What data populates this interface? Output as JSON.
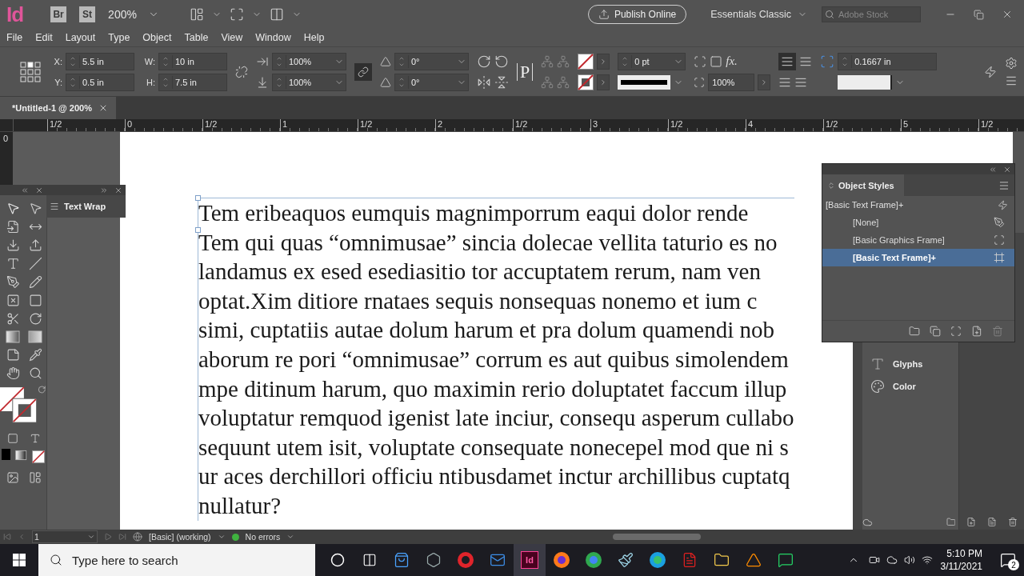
{
  "app_bar": {
    "logo": "Id",
    "bridge": "Br",
    "stock": "St",
    "zoom": "200%",
    "publish_button": "Publish Online",
    "workspace": "Essentials Classic",
    "stock_search": {
      "placeholder": "Adobe Stock"
    }
  },
  "menu": [
    "File",
    "Edit",
    "Layout",
    "Type",
    "Object",
    "Table",
    "View",
    "Window",
    "Help"
  ],
  "control_panel": {
    "position_fields": [
      {
        "label": "X:",
        "value": "5.5 in"
      },
      {
        "label": "Y:",
        "value": "0.5 in"
      }
    ],
    "size_fields": [
      {
        "label": "W:",
        "value": "10 in"
      },
      {
        "label": "H:",
        "value": "7.5 in"
      }
    ],
    "scale_fields": [
      "100%",
      "100%"
    ],
    "angle_fields": [
      "0°",
      "0°"
    ],
    "frame_glyph": "P",
    "stroke_weight": "0 pt",
    "effects": "fx.",
    "opacity": "100%",
    "inset": "0.1667 in"
  },
  "document_tab": {
    "title": "*Untitled-1 @ 200%"
  },
  "ruler": {
    "horizontal": [
      "1/2",
      "0",
      "1/2",
      "1",
      "1/2",
      "2",
      "1/2",
      "3",
      "1/2",
      "4",
      "1/2",
      "5",
      "1/2"
    ],
    "vertical": [
      "0"
    ]
  },
  "tools_panel": {
    "text_wrap_tab": "Text Wrap"
  },
  "text_frame": {
    "lines": [
      "Tem eribeaquos eumquis magnimporrum eaqui dolor rende",
      "Tem qui quas “omnimusae” sincia dolecae vellita taturio es no",
      "landamus ex esed esediasitio tor accuptatem rerum, nam ven",
      "optat.Xim ditiore rnataes sequis nonsequas nonemo et ium c",
      "simi, cuptatiis autae dolum harum et pra dolum quamendi nob",
      "aborum re pori “omnimusae” corrum es aut quibus simolendem",
      "mpe ditinum harum, quo maximin rerio doluptatet faccum illup",
      "voluptatur remquod igenist late inciur, consequ asperum cullabo",
      "sequunt utem isit, voluptate consequate nonecepel mod que ni s",
      "ur aces derchillori officiu ntibusdamet inctur archillibus cuptatq",
      "nullatur?"
    ]
  },
  "object_styles": {
    "title": "Object Styles",
    "current": "[Basic Text Frame]+",
    "items": [
      {
        "name": "[None]",
        "kind": "none",
        "selected": false
      },
      {
        "name": "[Basic Graphics Frame]",
        "kind": "graphics",
        "selected": false
      },
      {
        "name": "[Basic Text Frame]+",
        "kind": "text",
        "selected": true
      }
    ]
  },
  "dock_panels": [
    {
      "label": "Glyphs",
      "kind": "glyphs"
    },
    {
      "label": "Color",
      "kind": "color"
    }
  ],
  "status_bar": {
    "page": "1",
    "preflight_profile": "[Basic] (working)",
    "preflight_status": "No errors"
  },
  "taskbar": {
    "search": {
      "placeholder": "Type here to search"
    },
    "indesign_label": "Id",
    "time": "5:10 PM",
    "date": "3/11/2021",
    "notifications": "2"
  }
}
